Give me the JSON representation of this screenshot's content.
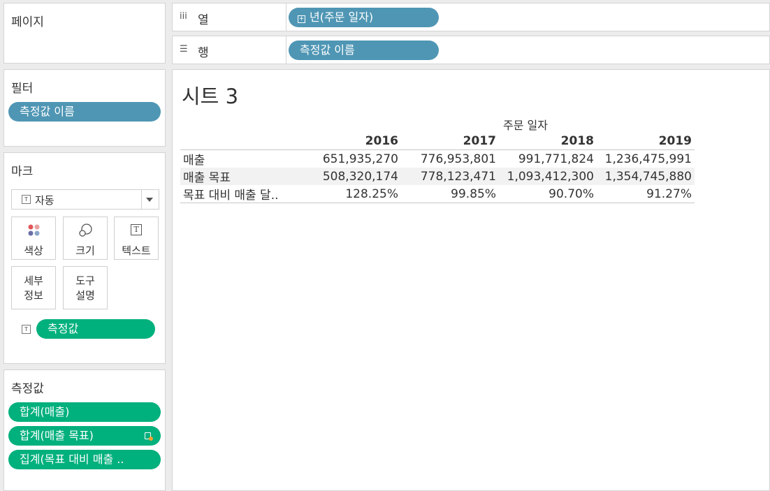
{
  "panels": {
    "pages": {
      "title": "페이지"
    },
    "filters": {
      "title": "필터",
      "pills": [
        "측정값 이름"
      ]
    },
    "marks": {
      "title": "마크",
      "mark_type": "자동",
      "buttons": {
        "color": "색상",
        "size": "크기",
        "text": "텍스트",
        "detail_1": "세부",
        "detail_2": "정보",
        "tooltip_1": "도구",
        "tooltip_2": "설명"
      },
      "text_pill": "측정값"
    },
    "measure_values": {
      "title": "측정값",
      "pills": [
        "합계(매출)",
        "합계(매출 목표)",
        "집계(목표 대비 매출 .."
      ]
    }
  },
  "shelves": {
    "columns": {
      "label": "열",
      "pill": "년(주문 일자)"
    },
    "rows": {
      "label": "행",
      "pill": "측정값 이름"
    }
  },
  "sheet": {
    "title": "시트 3",
    "column_header": "주문 일자",
    "years": [
      "2016",
      "2017",
      "2018",
      "2019"
    ],
    "rows": [
      {
        "label": "매출",
        "values": [
          "651,935,270",
          "776,953,801",
          "991,771,824",
          "1,236,475,991"
        ]
      },
      {
        "label": "매출 목표",
        "values": [
          "508,320,174",
          "778,123,471",
          "1,093,412,300",
          "1,354,745,880"
        ]
      },
      {
        "label": "목표 대비 매출 달..",
        "values": [
          "128.25%",
          "99.85%",
          "90.70%",
          "91.27%"
        ]
      }
    ]
  },
  "colors": {
    "dimension_pill": "#4f96b4",
    "measure_pill": "#00b07d"
  }
}
